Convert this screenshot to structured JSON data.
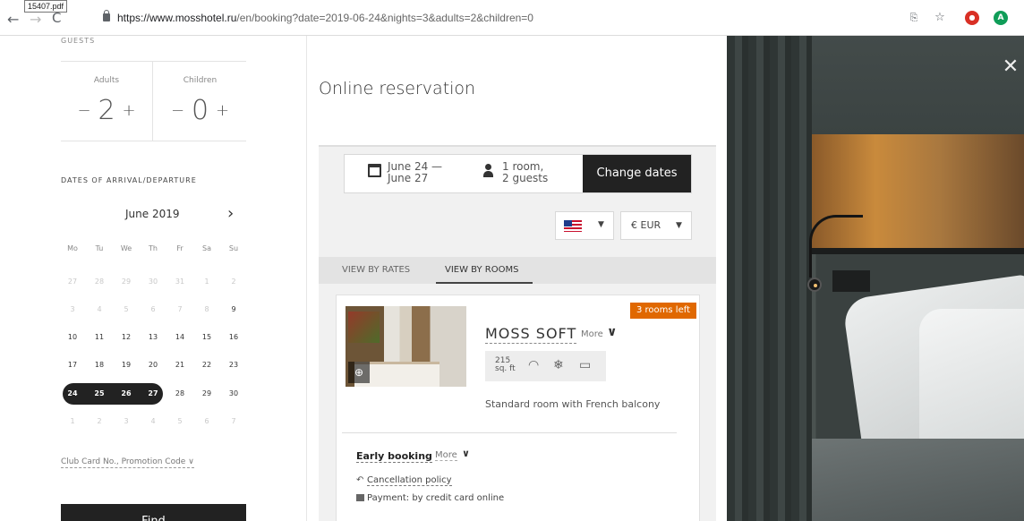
{
  "browser": {
    "tooltip": "15407.pdf",
    "url_host": "https://www.mosshotel.ru",
    "url_path": "/en/booking?date=2019-06-24&nights=3&adults=2&children=0"
  },
  "guests": {
    "label": "GUESTS",
    "adults_label": "Adults",
    "adults_value": "2",
    "children_label": "Children",
    "children_value": "0",
    "minus": "−",
    "plus": "+"
  },
  "calendar": {
    "label": "DATES OF ARRIVAL/DEPARTURE",
    "month": "June 2019",
    "next": "›",
    "weekdays": [
      "Mo",
      "Tu",
      "We",
      "Th",
      "Fr",
      "Sa",
      "Su"
    ],
    "weeks": [
      [
        "27",
        "28",
        "29",
        "30",
        "31",
        "1",
        "2"
      ],
      [
        "3",
        "4",
        "5",
        "6",
        "7",
        "8",
        "9"
      ],
      [
        "10",
        "11",
        "12",
        "13",
        "14",
        "15",
        "16"
      ],
      [
        "17",
        "18",
        "19",
        "20",
        "21",
        "22",
        "23"
      ],
      [
        "24",
        "25",
        "26",
        "27",
        "28",
        "29",
        "30"
      ],
      [
        "1",
        "2",
        "3",
        "4",
        "5",
        "6",
        "7"
      ]
    ],
    "promo": "Club Card No., Promotion Code ∨",
    "find_label": "Find"
  },
  "reservation": {
    "title": "Online reservation",
    "dates_line1": "June 24 —",
    "dates_line2": "June 27",
    "guests_line1": "1 room,",
    "guests_line2": "2 guests",
    "change_label": "Change dates",
    "currency": "€ EUR",
    "tabs": [
      "VIEW BY RATES",
      "VIEW BY ROOMS"
    ],
    "room": {
      "badge": "3 rooms left",
      "name": "MOSS SOFT",
      "more": "More",
      "area_line1": "215",
      "area_line2": "sq. ft",
      "description": "Standard room with French balcony",
      "rate_name": "Early booking",
      "rate_more": "More",
      "cancellation": "Cancellation policy",
      "payment": "Payment: by credit card online"
    }
  }
}
